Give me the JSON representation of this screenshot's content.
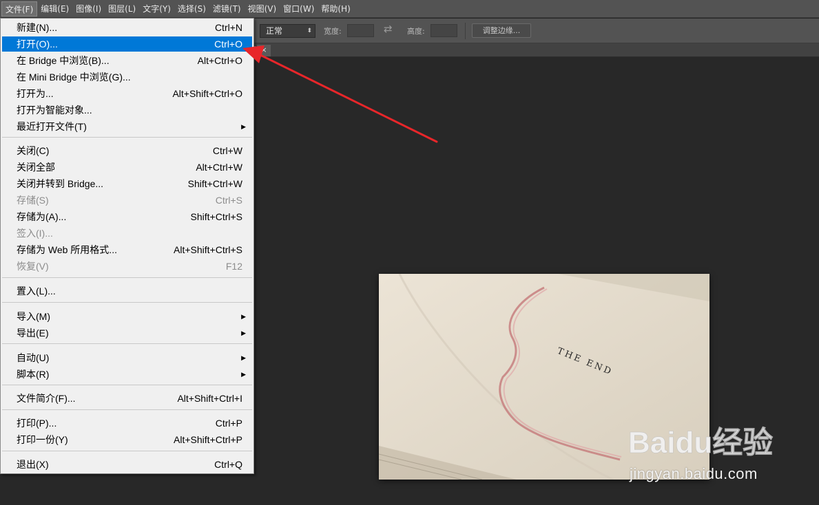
{
  "menubar": {
    "items": [
      "文件(F)",
      "编辑(E)",
      "图像(I)",
      "图层(L)",
      "文字(Y)",
      "选择(S)",
      "滤镜(T)",
      "视图(V)",
      "窗口(W)",
      "帮助(H)"
    ]
  },
  "options": {
    "mode": "正常",
    "width_label": "宽度:",
    "height_label": "高度:",
    "refine_button": "调整边缘..."
  },
  "tab": {
    "close": "×"
  },
  "file_menu": {
    "items": [
      {
        "label": "新建(N)...",
        "shortcut": "Ctrl+N"
      },
      {
        "label": "打开(O)...",
        "shortcut": "Ctrl+O"
      },
      {
        "label": "在 Bridge 中浏览(B)...",
        "shortcut": "Alt+Ctrl+O"
      },
      {
        "label": "在 Mini Bridge 中浏览(G)...",
        "shortcut": ""
      },
      {
        "label": "打开为...",
        "shortcut": "Alt+Shift+Ctrl+O"
      },
      {
        "label": "打开为智能对象...",
        "shortcut": ""
      },
      {
        "label": "最近打开文件(T)",
        "shortcut": ""
      },
      {
        "label": "关闭(C)",
        "shortcut": "Ctrl+W"
      },
      {
        "label": "关闭全部",
        "shortcut": "Alt+Ctrl+W"
      },
      {
        "label": "关闭并转到 Bridge...",
        "shortcut": "Shift+Ctrl+W"
      },
      {
        "label": "存储(S)",
        "shortcut": "Ctrl+S"
      },
      {
        "label": "存储为(A)...",
        "shortcut": "Shift+Ctrl+S"
      },
      {
        "label": "签入(I)...",
        "shortcut": ""
      },
      {
        "label": "存储为 Web 所用格式...",
        "shortcut": "Alt+Shift+Ctrl+S"
      },
      {
        "label": "恢复(V)",
        "shortcut": "F12"
      },
      {
        "label": "置入(L)...",
        "shortcut": ""
      },
      {
        "label": "导入(M)",
        "shortcut": ""
      },
      {
        "label": "导出(E)",
        "shortcut": ""
      },
      {
        "label": "自动(U)",
        "shortcut": ""
      },
      {
        "label": "脚本(R)",
        "shortcut": ""
      },
      {
        "label": "文件简介(F)...",
        "shortcut": "Alt+Shift+Ctrl+I"
      },
      {
        "label": "打印(P)...",
        "shortcut": "Ctrl+P"
      },
      {
        "label": "打印一份(Y)",
        "shortcut": "Alt+Shift+Ctrl+P"
      },
      {
        "label": "退出(X)",
        "shortcut": "Ctrl+Q"
      }
    ]
  },
  "photo": {
    "text": "THE END"
  },
  "watermark": {
    "brand": "Baidu经验",
    "domain": "jingyan.baidu.com"
  },
  "colors": {
    "highlight": "#0078d7",
    "arrow": "#e8262a",
    "menubar": "#535353",
    "canvas": "#282828"
  }
}
